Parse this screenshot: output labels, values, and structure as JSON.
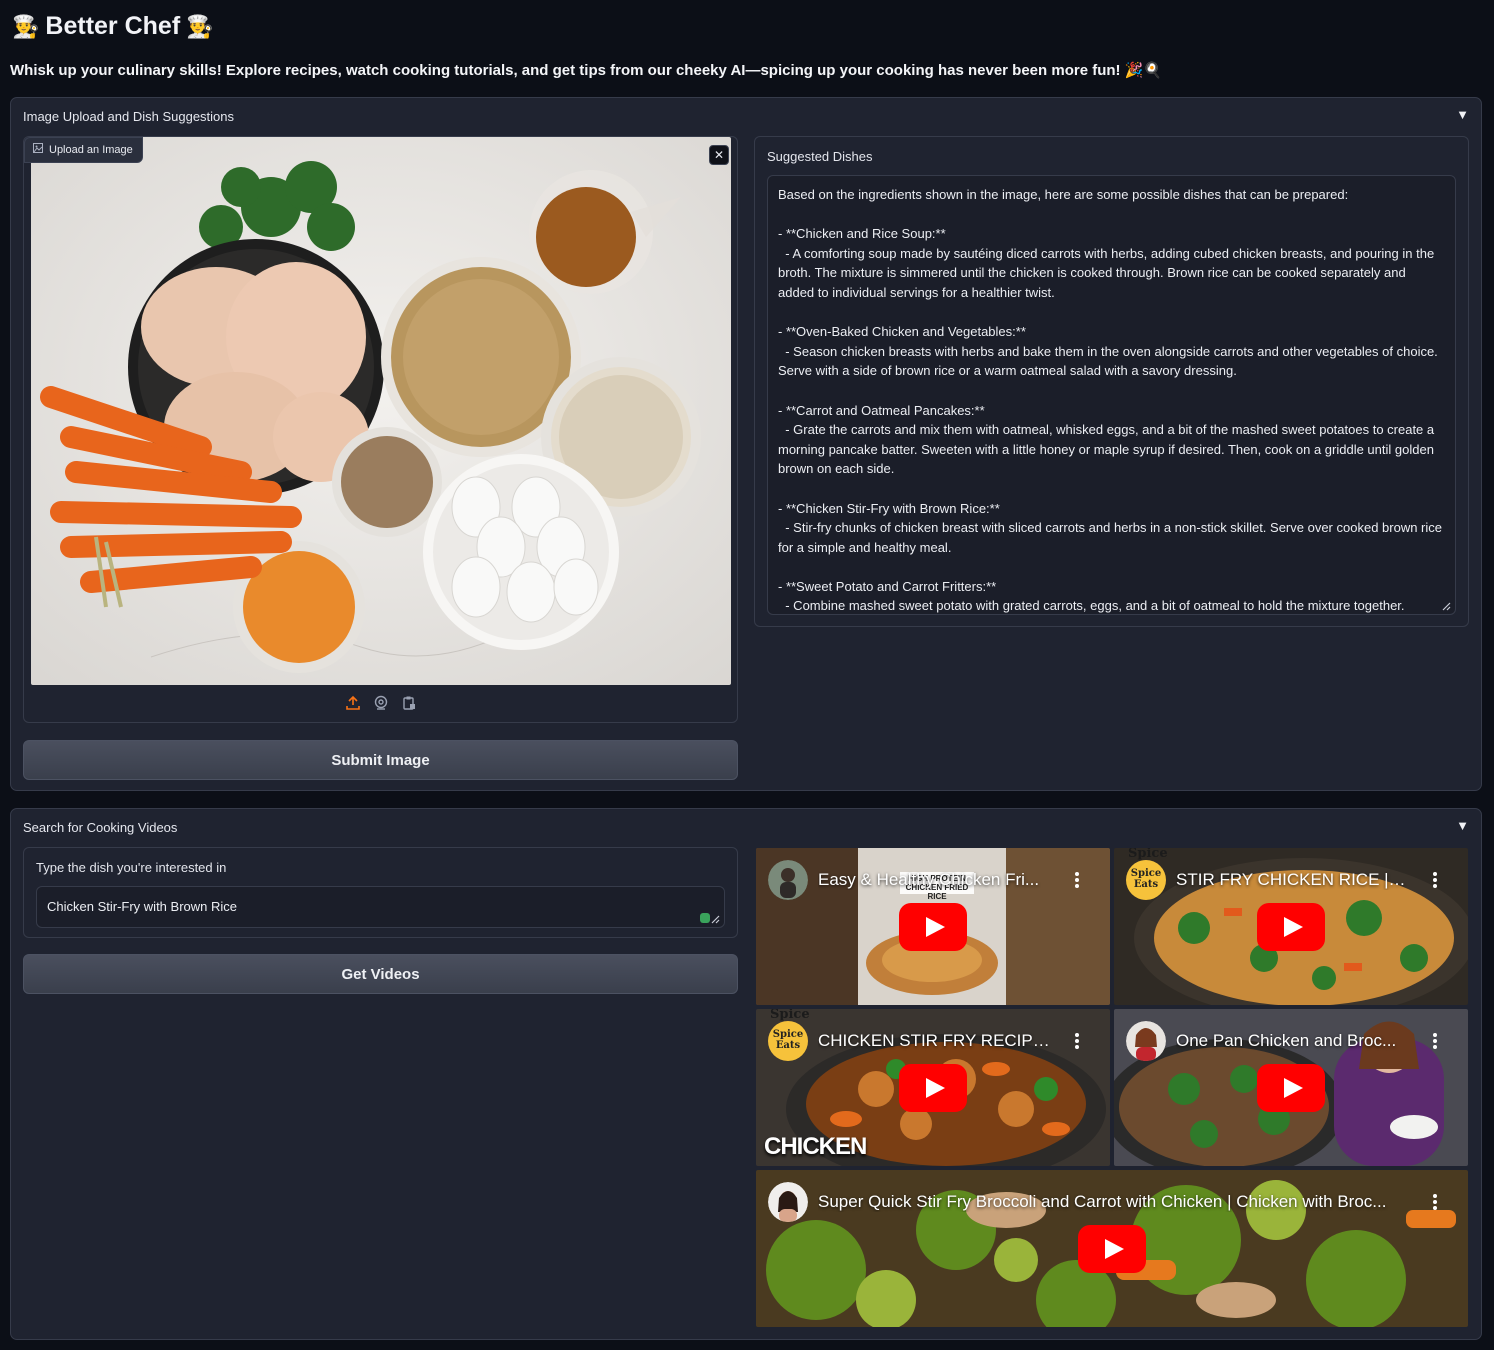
{
  "header": {
    "title": "Better Chef",
    "subtitle": "Whisk up your culinary skills! Explore recipes, watch cooking tutorials, and get tips from our cheeky AI—spicing up your cooking has never been more fun! 🎉🍳"
  },
  "upload_panel": {
    "title": "Image Upload and Dish Suggestions",
    "toggle": "▼",
    "image_label": "Upload an Image",
    "close": "✕",
    "submit_label": "Submit Image",
    "suggested_label": "Suggested Dishes",
    "suggested_text": "Based on the ingredients shown in the image, here are some possible dishes that can be prepared:\n\n- **Chicken and Rice Soup:**\n  - A comforting soup made by sautéing diced carrots with herbs, adding cubed chicken breasts, and pouring in the broth. The mixture is simmered until the chicken is cooked through. Brown rice can be cooked separately and added to individual servings for a healthier twist.\n\n- **Oven-Baked Chicken and Vegetables:**\n  - Season chicken breasts with herbs and bake them in the oven alongside carrots and other vegetables of choice. Serve with a side of brown rice or a warm oatmeal salad with a savory dressing.\n\n- **Carrot and Oatmeal Pancakes:**\n  - Grate the carrots and mix them with oatmeal, whisked eggs, and a bit of the mashed sweet potatoes to create a morning pancake batter. Sweeten with a little honey or maple syrup if desired. Then, cook on a griddle until golden brown on each side.\n\n- **Chicken Stir-Fry with Brown Rice:**\n  - Stir-fry chunks of chicken breast with sliced carrots and herbs in a non-stick skillet. Serve over cooked brown rice for a simple and healthy meal.\n\n- **Sweet Potato and Carrot Fritters:**\n  - Combine mashed sweet potato with grated carrots, eggs, and a bit of oatmeal to hold the mixture together."
  },
  "video_panel": {
    "title": "Search for Cooking Videos",
    "toggle": "▼",
    "input_label": "Type the dish you're interested in",
    "input_value": "Chicken Stir-Fry with Brown Rice",
    "button_label": "Get Videos",
    "videos": [
      {
        "title": "Easy & Healthy Chicken Fri..."
      },
      {
        "title": "STIR FRY CHICKEN RICE | S..."
      },
      {
        "title": "CHICKEN STIR FRY RECIPE..."
      },
      {
        "title": "One Pan Chicken and Broc..."
      },
      {
        "title": "Super Quick Stir Fry Broccoli and Carrot with Chicken | Chicken with Broc..."
      }
    ],
    "thumb_overlays": {
      "v1": "HIGH PROTEIN CHICKEN FRIED RICE",
      "spice_top": "Spice",
      "spice_badge_1": "Spice",
      "spice_badge_2": "Eats",
      "v3_caption": "CHICKEN"
    }
  },
  "colors": {
    "background": "#0c0f17",
    "panel": "#1f2330",
    "border": "#363b4a",
    "accent": "#f97316",
    "youtube_red": "#ff0000"
  }
}
